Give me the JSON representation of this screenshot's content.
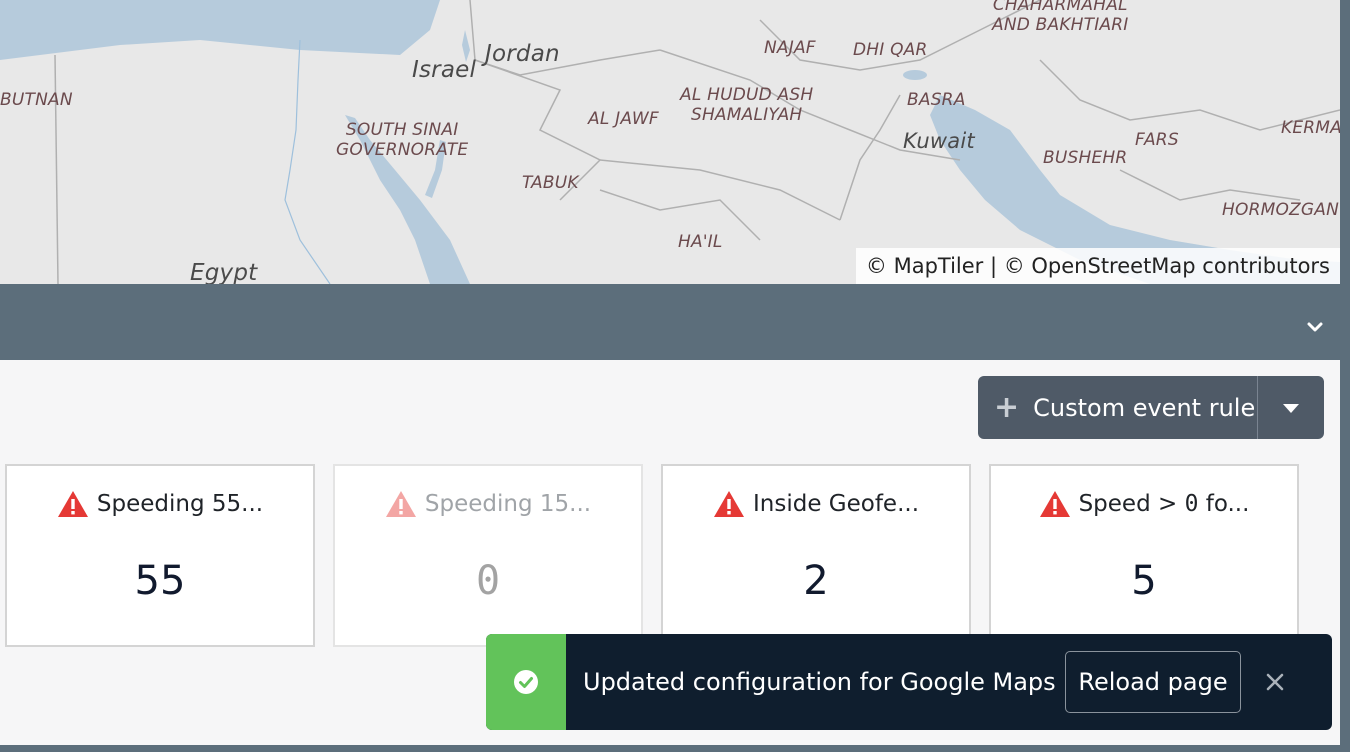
{
  "map": {
    "labels": {
      "butnan": "BUTNAN",
      "israel": "Israel",
      "jordan": "Jordan",
      "south_sinai": "SOUTH SINAI\nGOVERNORATE",
      "al_jawf": "AL JAWF",
      "al_hudud": "AL HUDUD ASH\nSHAMALIYAH",
      "najaf": "NAJAF",
      "dhi_qar": "DHI QAR",
      "basra": "BASRA",
      "kuwait": "Kuwait",
      "chaharmahal": "CHAHARMAHAL\nAND BAKHTIARI",
      "bushehr": "BUSHEHR",
      "fars": "FARS",
      "kerma": "KERMA",
      "hormozgan": "HORMOZGAN",
      "tabuk": "TABUK",
      "hail": "HA'IL",
      "egypt": "Egypt"
    },
    "attribution": "© MapTiler | © OpenStreetMap contributors"
  },
  "toolbar": {
    "custom_rule_label": "Custom event rule"
  },
  "cards": [
    {
      "title": "Speeding 55...",
      "value": "55",
      "muted": false
    },
    {
      "title": "Speeding 15...",
      "value": "0",
      "muted": true
    },
    {
      "title": "Inside Geofe...",
      "value": "2",
      "muted": false
    },
    {
      "title_prefix": "Speed > ",
      "title_mono": "0",
      "title_suffix": " fo...",
      "value": "5",
      "muted": false
    }
  ],
  "toast": {
    "message": "Updated configuration for Google Maps",
    "reload_label": "Reload page"
  },
  "colors": {
    "warning": "#e53935",
    "success": "#62c35a",
    "water": "#b6cbdc"
  }
}
